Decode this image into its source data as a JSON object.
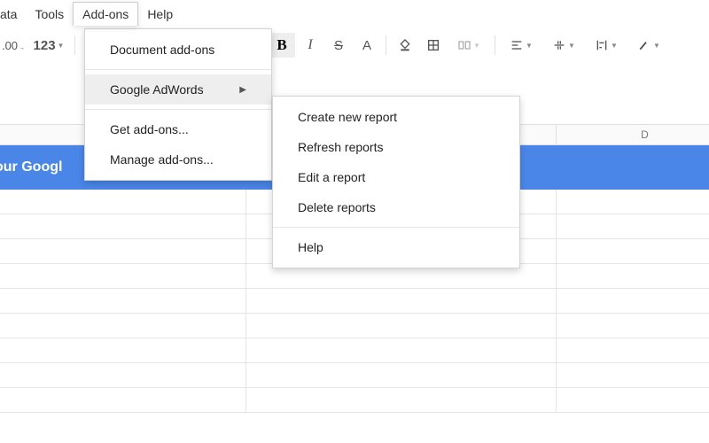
{
  "menubar": {
    "items": [
      {
        "label": "ata"
      },
      {
        "label": "Tools"
      },
      {
        "label": "Add-ons"
      },
      {
        "label": "Help"
      }
    ],
    "active_index": 2
  },
  "toolbar": {
    "decimal_decrease": ".00",
    "format_more": "123",
    "bold": "B",
    "italic": "I",
    "strike": "S",
    "text_color": "A"
  },
  "addons_menu": {
    "document_addons": "Document add-ons",
    "adwords": "Google AdWords",
    "get_addons": "Get add-ons...",
    "manage_addons": "Manage add-ons..."
  },
  "adwords_submenu": {
    "create": "Create new report",
    "refresh": "Refresh reports",
    "edit": "Edit a report",
    "delete": "Delete reports",
    "help": "Help"
  },
  "sheet": {
    "columns": {
      "D": "D"
    },
    "blue_row_text": "our Googl"
  }
}
